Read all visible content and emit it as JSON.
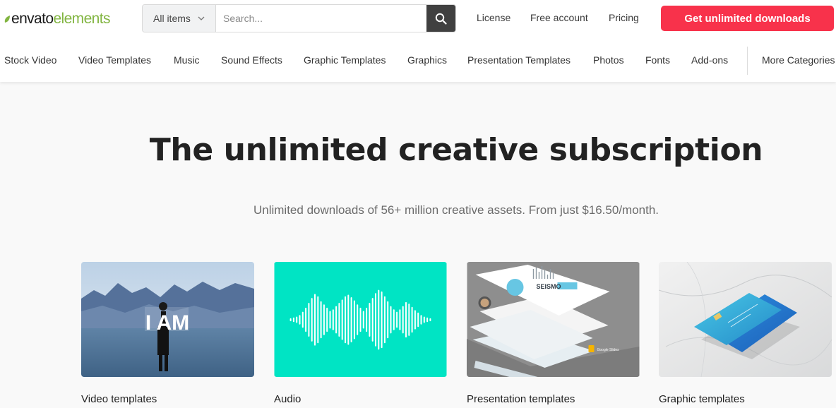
{
  "brand": {
    "logo_part1": "envato",
    "logo_part2": "elements",
    "accent": "#82b541",
    "cta_color": "#f8324b"
  },
  "search": {
    "category": "All items",
    "placeholder": "Search...",
    "value": ""
  },
  "header": {
    "links": [
      "License",
      "Free account",
      "Pricing"
    ],
    "cta": "Get unlimited downloads"
  },
  "categories": [
    "Stock Video",
    "Video Templates",
    "Music",
    "Sound Effects",
    "Graphic Templates",
    "Graphics",
    "Presentation Templates",
    "Photos",
    "Fonts",
    "Add-ons"
  ],
  "more_categories": "More Categories",
  "hero": {
    "title": "The unlimited creative subscription",
    "subtitle": "Unlimited downloads of 56+ million creative assets. From just $16.50/month."
  },
  "cards": [
    {
      "label": "Video templates",
      "overlay": "I AM"
    },
    {
      "label": "Audio"
    },
    {
      "label": "Presentation templates",
      "overlay_title": "SEISMO",
      "overlay_badge": "Google Slides"
    },
    {
      "label": "Graphic templates"
    }
  ]
}
